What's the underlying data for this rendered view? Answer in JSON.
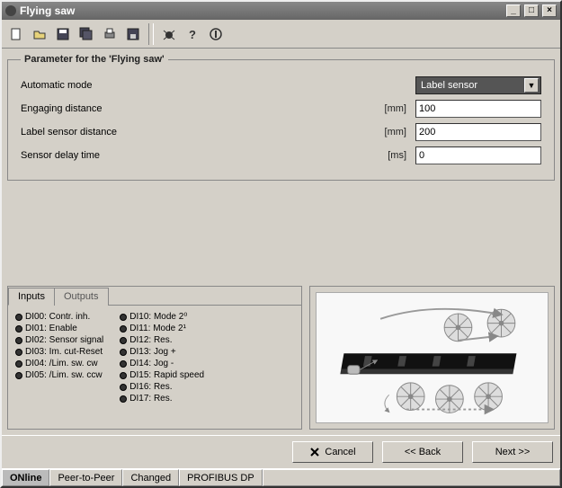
{
  "window": {
    "title": "Flying saw"
  },
  "toolbar_icons": [
    "new",
    "open",
    "save",
    "save-all",
    "print",
    "copy",
    "sep",
    "properties",
    "help",
    "about"
  ],
  "groupbox": {
    "legend": "Parameter for the 'Flying saw'",
    "rows": [
      {
        "label": "Automatic mode",
        "unit": "",
        "type": "select",
        "value": "Label sensor"
      },
      {
        "label": "Engaging distance",
        "unit": "[mm]",
        "type": "text",
        "value": "100"
      },
      {
        "label": "Label sensor distance",
        "unit": "[mm]",
        "type": "text",
        "value": "200"
      },
      {
        "label": "Sensor delay time",
        "unit": "[ms]",
        "type": "text",
        "value": "0"
      }
    ]
  },
  "tabs": {
    "items": [
      "Inputs",
      "Outputs"
    ],
    "active": 0
  },
  "di_left": [
    "DI00: Contr. inh.",
    "DI01: Enable",
    "DI02: Sensor signal",
    "DI03: Im. cut-Reset",
    "DI04: /Lim. sw. cw",
    "DI05: /Lim. sw. ccw"
  ],
  "di_right": [
    "DI10: Mode 2⁰",
    "DI11: Mode 2¹",
    "DI12: Res.",
    "DI13: Jog +",
    "DI14: Jog -",
    "DI15: Rapid speed",
    "DI16: Res.",
    "DI17: Res."
  ],
  "buttons": {
    "cancel": "Cancel",
    "back": "<< Back",
    "next": "Next >>"
  },
  "status": {
    "cells": [
      "ONline",
      "Peer-to-Peer",
      "Changed",
      "PROFIBUS DP"
    ]
  }
}
